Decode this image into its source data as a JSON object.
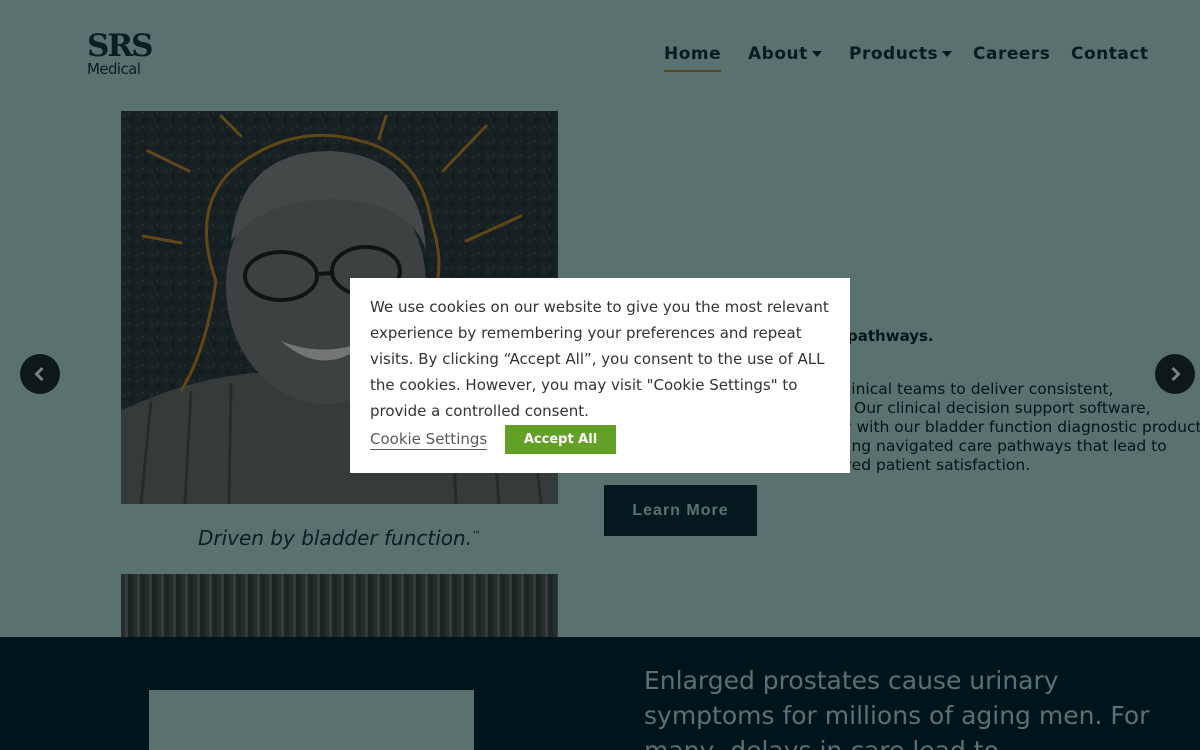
{
  "header": {
    "logo": {
      "line1": "SRS",
      "line2": "Medical"
    },
    "nav": [
      {
        "label": "Home"
      },
      {
        "label": "About"
      },
      {
        "label": "Products"
      },
      {
        "label": "Careers"
      },
      {
        "label": "Contact"
      }
    ]
  },
  "hero": {
    "caption": "Driven by bladder function.",
    "caption_mark": "™",
    "subheading_fragment": "pathways.",
    "body_lines": [
      "linical teams to deliver consistent,",
      "ts. Our clinical decision support software,",
      "sly with our bladder function diagnostic products",
      "bling navigated care pathways that lead to",
      "oved patient satisfaction."
    ],
    "cta_label": "Learn More"
  },
  "carousel": {
    "prev_icon": "chevron-left-icon",
    "next_icon": "chevron-right-icon"
  },
  "section": {
    "text": "Enlarged prostates cause urinary symptoms for millions of aging men. For many, delays in care lead to"
  },
  "cookie_modal": {
    "message": "We use cookies on our website to give you the most relevant experience by remembering your preferences and repeat visits. By clicking “Accept All”, you consent to the use of ALL the cookies. However, you may visit \"Cookie Settings\" to provide a controlled consent.",
    "settings_label": "Cookie Settings",
    "accept_label": "Accept All"
  },
  "colors": {
    "page_bg": "#b3e2df",
    "dark_teal": "#002a36",
    "accent_gold": "#c38c2c",
    "accept_green": "#62a125"
  }
}
